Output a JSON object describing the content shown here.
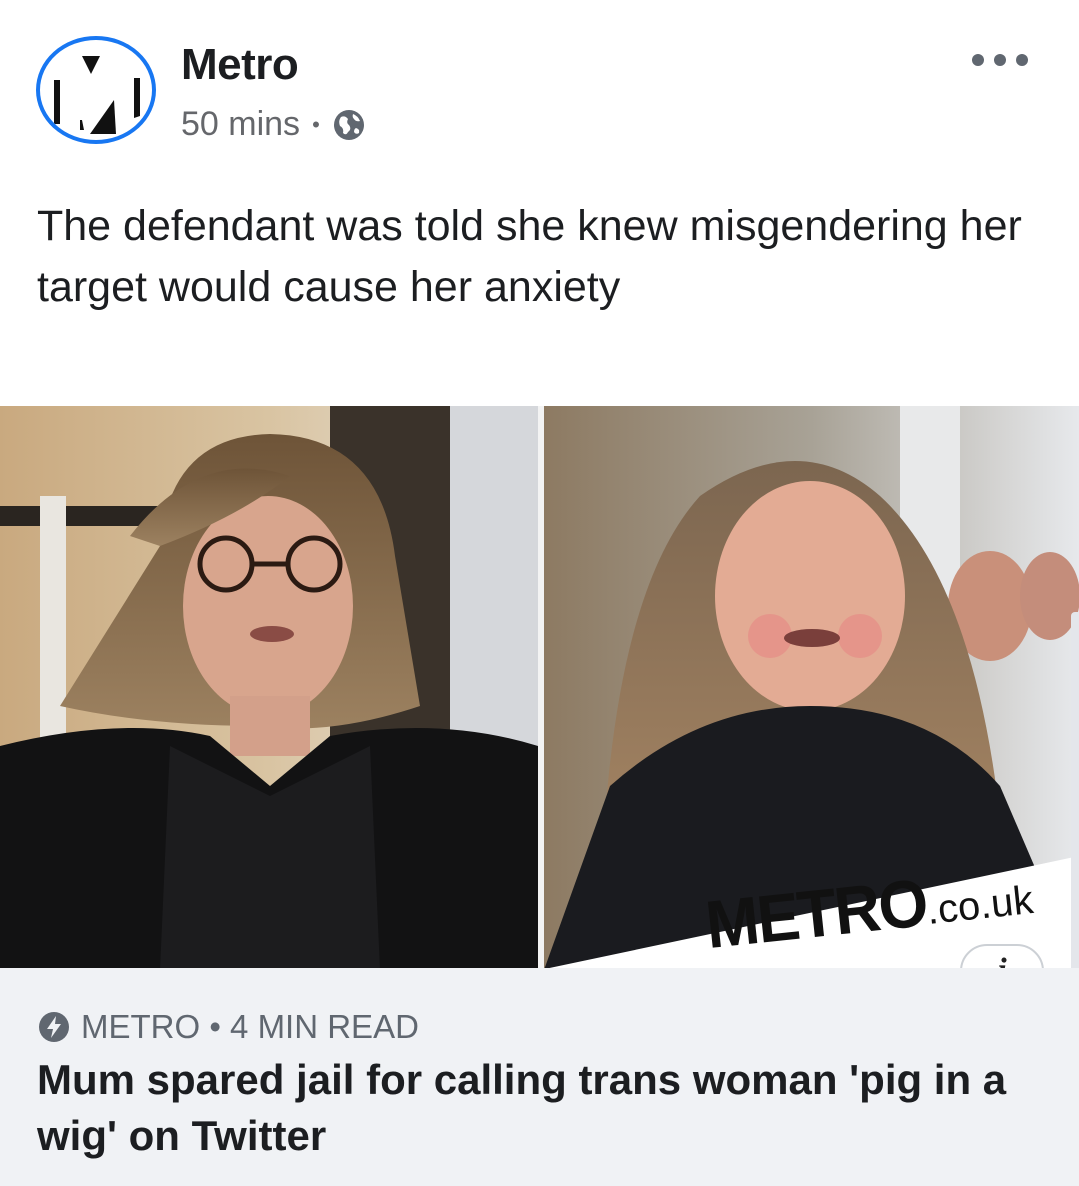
{
  "post": {
    "page_name": "Metro",
    "time": "50 mins",
    "separator": "•",
    "privacy_icon": "globe-icon",
    "more_icon": "more-horizontal-icon",
    "caption": "The defendant was told she knew misgendering her target would cause her anxiety"
  },
  "image": {
    "watermark_brand": "METRO",
    "watermark_domain": ".co.uk",
    "info_label": "i"
  },
  "link": {
    "source_icon": "lightning-bolt-icon",
    "source": "METRO • 4 MIN READ",
    "headline": "Mum spared jail for calling trans woman 'pig in a wig' on Twitter"
  },
  "colors": {
    "accent": "#1877f2",
    "card_bg": "#f0f2f5",
    "text": "#1c1e21",
    "muted": "#65676b"
  }
}
